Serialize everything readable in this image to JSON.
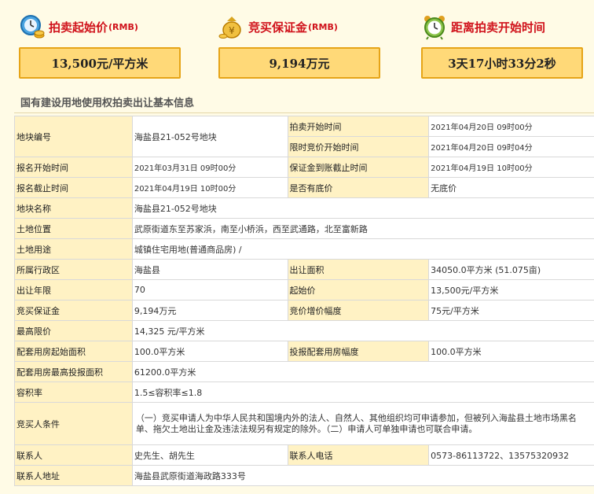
{
  "summary": {
    "start_price": {
      "label": "拍卖起始价",
      "unit_tag": "(RMB)",
      "icon": "clock-money-icon",
      "value": "13,500元/平方米"
    },
    "deposit": {
      "label": "竞买保证金",
      "unit_tag": "(RMB)",
      "icon": "money-bag-icon",
      "value": "9,194万元"
    },
    "countdown": {
      "label": "距离拍卖开始时间",
      "icon": "alarm-clock-icon",
      "value": "3天17小时33分2秒"
    }
  },
  "section_title": "国有建设用地使用权拍卖出让基本信息",
  "rows": {
    "plot_no": {
      "label": "地块编号",
      "value": "海盐县21-052号地块"
    },
    "auction_start": {
      "label": "拍卖开始时间",
      "value": "2021年04月20日 09时00分"
    },
    "limit_bid_start": {
      "label": "限时竞价开始时间",
      "value": "2021年04月20日 09时04分"
    },
    "reg_start": {
      "label": "报名开始时间",
      "value": "2021年03月31日 09时00分"
    },
    "deposit_deadline": {
      "label": "保证金到账截止时间",
      "value": "2021年04月19日 10时00分"
    },
    "reg_end": {
      "label": "报名截止时间",
      "value": "2021年04月19日 10时00分"
    },
    "reserve": {
      "label": "是否有底价",
      "value": "无底价"
    },
    "plot_name": {
      "label": "地块名称",
      "value": "海盐县21-052号地块"
    },
    "location": {
      "label": "土地位置",
      "value": "武原街道东至苏家浜，南至小桥浜，西至武通路，北至富新路"
    },
    "usage": {
      "label": "土地用途",
      "value": "城镇住宅用地(普通商品房) /"
    },
    "district": {
      "label": "所属行政区",
      "value": "海盐县"
    },
    "area": {
      "label": "出让面积",
      "value": "34050.0平方米 (51.075亩)"
    },
    "term": {
      "label": "出让年限",
      "value": "70"
    },
    "start_price": {
      "label": "起始价",
      "value": "13,500元/平方米"
    },
    "bid_deposit": {
      "label": "竞买保证金",
      "value": "9,194万元"
    },
    "increment": {
      "label": "竞价增价幅度",
      "value": "75元/平方米"
    },
    "max_price": {
      "label": "最高限价",
      "value": "14,325 元/平方米"
    },
    "housing_start_area": {
      "label": "配套用房起始面积",
      "value": "100.0平方米"
    },
    "housing_increment": {
      "label": "投报配套用房幅度",
      "value": "100.0平方米"
    },
    "housing_max": {
      "label": "配套用房最高投报面积",
      "value": "61200.0平方米"
    },
    "far": {
      "label": "容积率",
      "value": "1.5≤容积率≤1.8"
    },
    "conditions": {
      "label": "竞买人条件",
      "value": "（一）竞买申请人为中华人民共和国境内外的法人、自然人、其他组织均可申请参加，但被列入海盐县土地市场黑名单、拖欠土地出让金及违法法规另有规定的除外。（二）申请人可单独申请也可联合申请。"
    },
    "contact": {
      "label": "联系人",
      "value": "史先生、胡先生"
    },
    "phone": {
      "label": "联系人电话",
      "value": "0573-86113722、13575320932"
    },
    "address": {
      "label": "联系人地址",
      "value": "海盐县武原街道海政路333号"
    }
  },
  "colors": {
    "accent_red": "#d0121b",
    "box_fill": "#ffd978",
    "box_border": "#e6a417",
    "label_cell": "#fff2c4"
  }
}
